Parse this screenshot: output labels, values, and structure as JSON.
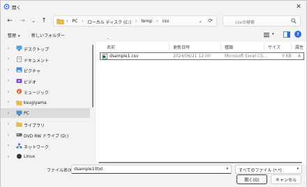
{
  "titlebar": {
    "title": "開く",
    "close": "✕"
  },
  "nav": {
    "back": "←",
    "forward": "→",
    "up_caret": "⌄",
    "up": "↑",
    "breadcrumbs": [
      {
        "label": "PC"
      },
      {
        "label": "ローカル ディスク (C:)"
      },
      {
        "label": "temp"
      },
      {
        "label": "csv"
      }
    ],
    "separator": "›",
    "search_placeholder": "csvの検索"
  },
  "commandbar": {
    "organize": "整理",
    "new_folder": "新しいフォルダー"
  },
  "navpane": {
    "items": [
      {
        "label": "デスクトップ",
        "icon": "desktop-icon",
        "color": "#4aa3df"
      },
      {
        "label": "ドキュメント",
        "icon": "document-icon",
        "color": "#7a7a7a"
      },
      {
        "label": "ピクチャ",
        "icon": "picture-icon",
        "color": "#3f8fe0"
      },
      {
        "label": "ビデオ",
        "icon": "video-icon",
        "color": "#8a4fd0"
      },
      {
        "label": "ミュージック",
        "icon": "music-icon",
        "color": "#e0663a"
      },
      {
        "label": "ksugiyama",
        "icon": "folder-icon",
        "color": "#e8b94a"
      },
      {
        "label": "PC",
        "icon": "pc-icon",
        "color": "#4a90d0",
        "selected": true
      },
      {
        "label": "ライブラリ",
        "icon": "library-folder-icon",
        "color": "#e8b94a"
      },
      {
        "label": "DVD RW ドライブ (D:)",
        "icon": "dvd-drive-icon",
        "color": "#6a6a6a"
      },
      {
        "label": "ネットワーク",
        "icon": "network-icon",
        "color": "#4a7ac0"
      },
      {
        "label": "Linux",
        "icon": "linux-icon",
        "color": "#333333"
      }
    ]
  },
  "filelist": {
    "columns": {
      "name": "名前",
      "modified": "更新日時",
      "type": "種類",
      "size": "サイズ",
      "attr": "属性"
    },
    "sort_caret": "^",
    "rows": [
      {
        "name": "dsample1.csv",
        "modified": "2024/06/21 12:00",
        "type": "Microsoft Excel CS...",
        "size": "0 KB",
        "attr": "A"
      }
    ]
  },
  "footer": {
    "filename_label": "ファイル名(N):",
    "filename_value": "dsample10txt",
    "filetype_value": "すべてのファイル (*.*)",
    "open_button": "開く(O)",
    "cancel_button": "キャンセル"
  },
  "colors": {
    "accent": "#2a6fd6",
    "csv_green": "#1e7145"
  }
}
